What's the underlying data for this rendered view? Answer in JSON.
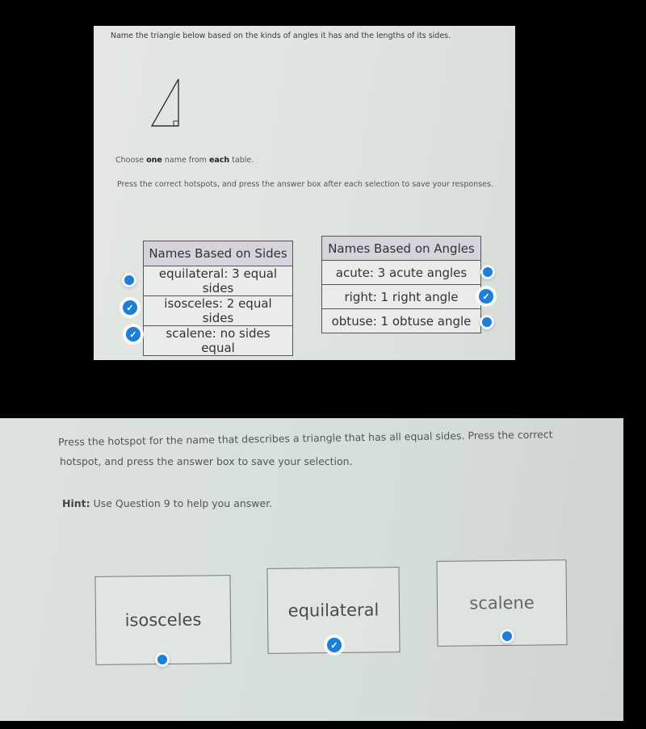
{
  "question9": {
    "prompt": "Name the triangle below based on the kinds of angles it has and the lengths of its sides.",
    "figure": "right-triangle",
    "instruction_choose_pre": "Choose ",
    "instruction_choose_one": "one",
    "instruction_choose_mid": " name from ",
    "instruction_choose_each": "each",
    "instruction_choose_post": " table.",
    "instruction_hotspots": "Press the correct hotspots, and press the answer box after each selection to save your responses.",
    "sides_table": {
      "header": "Names Based on Sides",
      "rows": [
        {
          "label": "equilateral: 3 equal sides",
          "hotspot_state": "unselected"
        },
        {
          "label": "isosceles: 2 equal sides",
          "hotspot_state": "selected"
        },
        {
          "label": "scalene: no sides equal",
          "hotspot_state": "selected"
        }
      ]
    },
    "angles_table": {
      "header": "Names Based on Angles",
      "rows": [
        {
          "label": "acute: 3 acute angles",
          "hotspot_state": "unselected"
        },
        {
          "label": "right: 1 right angle",
          "hotspot_state": "selected"
        },
        {
          "label": "obtuse: 1 obtuse angle",
          "hotspot_state": "unselected"
        }
      ]
    }
  },
  "question10": {
    "prompt_line1": "Press the hotspot for the name that describes a triangle that has all equal sides. Press the correct",
    "prompt_line2": "hotspot, and press the answer box to save your selection.",
    "hint_label": "Hint:",
    "hint_text": " Use Question 9 to help you answer.",
    "options": [
      {
        "label": "isosceles",
        "hotspot_state": "unselected"
      },
      {
        "label": "equilateral",
        "hotspot_state": "selected"
      },
      {
        "label": "scalene",
        "hotspot_state": "unselected"
      }
    ]
  },
  "colors": {
    "hotspot_blue": "#1e7fd8",
    "table_header_bg": "#d6d3dc"
  },
  "icons": {
    "selected": "check-icon",
    "unselected": "dot-icon"
  }
}
